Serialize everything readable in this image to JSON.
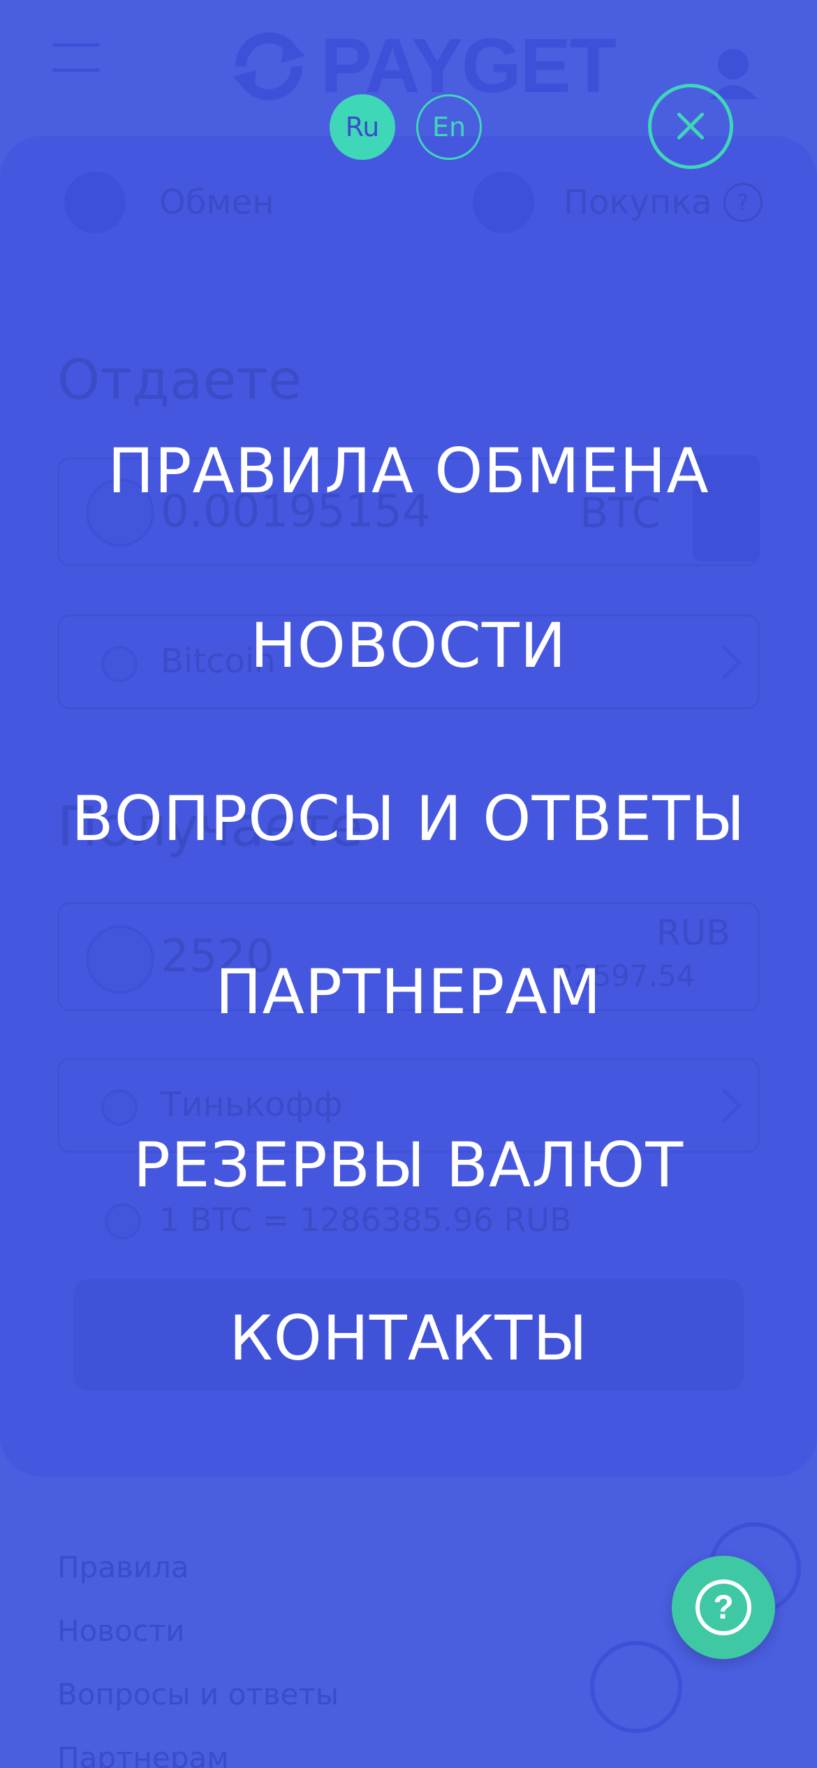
{
  "background": {
    "logo_text": "PAYGET",
    "tabs": [
      {
        "label": "Обмен"
      },
      {
        "label": "Покупка"
      }
    ],
    "help_mark": "?",
    "give": {
      "title": "Отдаете",
      "amount": "0.00195154",
      "currency": "BTC",
      "method": "Bitcoin"
    },
    "receive": {
      "title": "Получаете",
      "amount": "2520",
      "currency": "RUB",
      "limit": "22597.54",
      "method": "Тинькофф"
    },
    "rate": "1 BTC = 1286385.96 RUB",
    "footer_links": [
      "Правила",
      "Новости",
      "Вопросы и ответы",
      "Партнерам"
    ]
  },
  "overlay": {
    "languages": [
      {
        "code": "Ru",
        "active": true
      },
      {
        "code": "En",
        "active": false
      }
    ],
    "menu_items": [
      "ПРАВИЛА ОБМЕНА",
      "НОВОСТИ",
      "ВОПРОСЫ И ОТВЕТЫ",
      "ПАРТНЕРАМ",
      "РЕЗЕРВЫ ВАЛЮТ",
      "КОНТАКТЫ"
    ],
    "help_label": "?"
  },
  "colors": {
    "background": "#4a5ee0",
    "accent": "#3ed8b8",
    "help_button": "#3ec9a4",
    "menu_text": "#ffffff"
  }
}
